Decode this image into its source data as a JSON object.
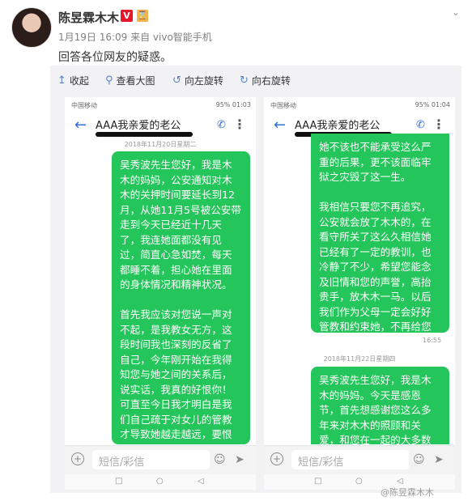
{
  "author": {
    "name": "陈昱霖木木",
    "verified_badge": "V",
    "rank_badge": "⌛",
    "meta": "1月19日 16:09 来自 vivo智能手机"
  },
  "post_text": "回答各位网友的疑惑。",
  "toolbar": {
    "collapse": "收起",
    "view_large": "查看大图",
    "rotate_left": "向左旋转",
    "rotate_right": "向右旋转"
  },
  "phone_left": {
    "status_left": "中国移动",
    "status_right": "95% 01:03",
    "title": "AAA我亲爱的老公",
    "date": "2018年11月20日星期二",
    "message": "吴秀波先生您好，我是木木的妈妈，公安通知对木木的关押时间要延长到12月，从她11月5号被公安带走到今天已经近十几天了，我连她面都没有见过，简直心急如焚，每天都睡不着，担心她在里面的身体情况和精神状况。\n\n首先我应该对您说一声对不起，是我教女无方，这段时间我也深刻的反省了自己，今年刚开始在我得知您与她之间的关系后，说实话，我真的好恨你！可直至今日我才明白是我们自己疏于对女儿的管教才导致她越走越远，要恨也该恨我自己！我们也意识到这次对她的惩罚也正",
    "input_placeholder": "短信/彩信"
  },
  "phone_right": {
    "status_left": "中国移动",
    "status_right": "95% 01:04",
    "title": "AAA我亲爱的老公",
    "message1": "她不该也不能承受这么严重的后果，更不该面临牢狱之灾毁了这一生。\n\n我相信只要您不再追究，公安就会放了木木的，在看守所关了这么久相信她已经有了一定的教训，也冷静了不少，希望您能念及旧情和您的声誉，高抬贵手，放木木一马。以后我们作为父母一定会好好管教和约束她，不再给您带来任何困扰，恳请您得饶人处且饶人！",
    "time1": "16:55",
    "date2": "2018年11月22日星期四",
    "message2": "吴秀波先生您好，我是木木的妈妈。今天是感恩节，首先想感谢您这么多年来对木木的照顾和关爱，和您在一起的大多数",
    "input_placeholder": "短信/彩信"
  },
  "watermark": "@陈昱霖木木"
}
